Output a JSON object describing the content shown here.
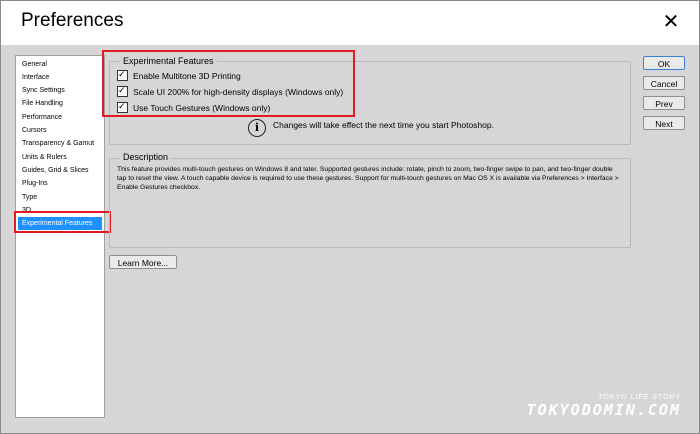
{
  "window": {
    "title": "Preferences",
    "close_glyph": "✕"
  },
  "sidebar": {
    "items": [
      {
        "label": "General"
      },
      {
        "label": "Interface"
      },
      {
        "label": "Sync Settings"
      },
      {
        "label": "File Handling"
      },
      {
        "label": "Performance"
      },
      {
        "label": "Cursors"
      },
      {
        "label": "Transparency & Gamut"
      },
      {
        "label": "Units & Rulers"
      },
      {
        "label": "Guides, Grid & Slices"
      },
      {
        "label": "Plug-Ins"
      },
      {
        "label": "Type"
      },
      {
        "label": "3D"
      },
      {
        "label": "Experimental Features"
      }
    ],
    "selected": "Experimental Features"
  },
  "experimental": {
    "legend": "Experimental Features",
    "options": [
      {
        "label": "Enable Multitone 3D Printing",
        "checked": true
      },
      {
        "label": "Scale UI 200% for high-density displays (Windows only)",
        "checked": true
      },
      {
        "label": "Use Touch Gestures (Windows only)",
        "checked": true
      }
    ],
    "info_glyph": "i",
    "notice": "Changes will take effect the next time you start Photoshop."
  },
  "description": {
    "legend": "Description",
    "text": "This feature provides multi-touch gestures on Windows 8 and later. Supported gestures include: rotate, pinch to zoom, two-finger swipe to pan, and two-finger double tap to reset the view. A touch capable device is required to use these gestures. Support for multi-touch gestures on Mac OS X is available via Preferences > Interface > Enable Gestures checkbox."
  },
  "buttons": {
    "learn_more": "Learn More...",
    "ok": "OK",
    "cancel": "Cancel",
    "prev": "Prev",
    "next": "Next"
  },
  "watermark": {
    "tagline": "TOKYO LIFE STORY",
    "brand": "TOKYODOMIN.COM"
  },
  "colors": {
    "selection": "#1e90ff",
    "highlight_box": "#e01b24"
  }
}
